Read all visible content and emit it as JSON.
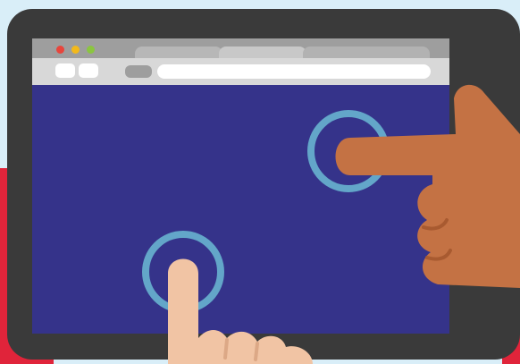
{
  "scene": {
    "icons": [
      "touch-target-icon",
      "touch-target-icon",
      "pointing-hand-icon",
      "pointing-hand-icon"
    ]
  },
  "colors": {
    "tablet_frame": "#3a3a3a",
    "screen": "#35338a",
    "touch_ring": "#63a6c9",
    "hand_dark": "#c47244",
    "hand_light": "#f1c4a4",
    "traffic_red": "#e8453c",
    "traffic_yellow": "#f3b91b",
    "traffic_green": "#8bc540"
  }
}
